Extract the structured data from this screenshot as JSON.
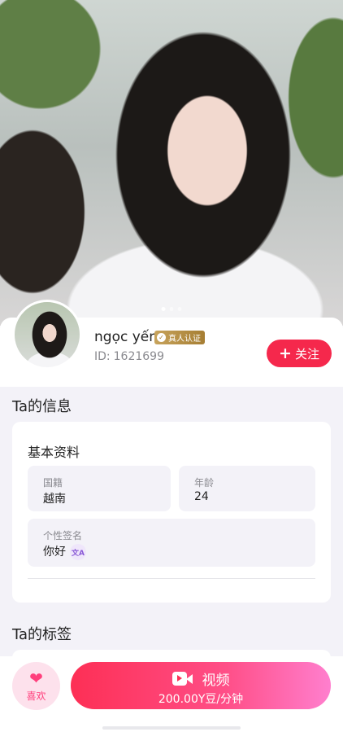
{
  "hero": {
    "dots": 3,
    "active_dot": 0
  },
  "profile": {
    "name": "ngọc yến",
    "verified_badge": "真人认证",
    "id_label": "ID:",
    "id_value": "1621699",
    "follow_label": "关注"
  },
  "info_section": {
    "title": "Ta的信息",
    "basic_title": "基本资料",
    "nationality_label": "国籍",
    "nationality_value": "越南",
    "age_label": "年龄",
    "age_value": "24",
    "signature_label": "个性签名",
    "signature_value": "你好"
  },
  "tags_section": {
    "title": "Ta的标签"
  },
  "bottom": {
    "like_label": "喜欢",
    "video_label": "视频",
    "price": "200.00Y豆/分钟"
  },
  "colors": {
    "accent": "#f5284c",
    "like_pink": "#ff3f7c",
    "badge_gold": "#b8913f"
  },
  "icons": [
    "heart-icon",
    "video-camera-icon",
    "translate-icon",
    "verified-check-icon",
    "plus-icon"
  ]
}
